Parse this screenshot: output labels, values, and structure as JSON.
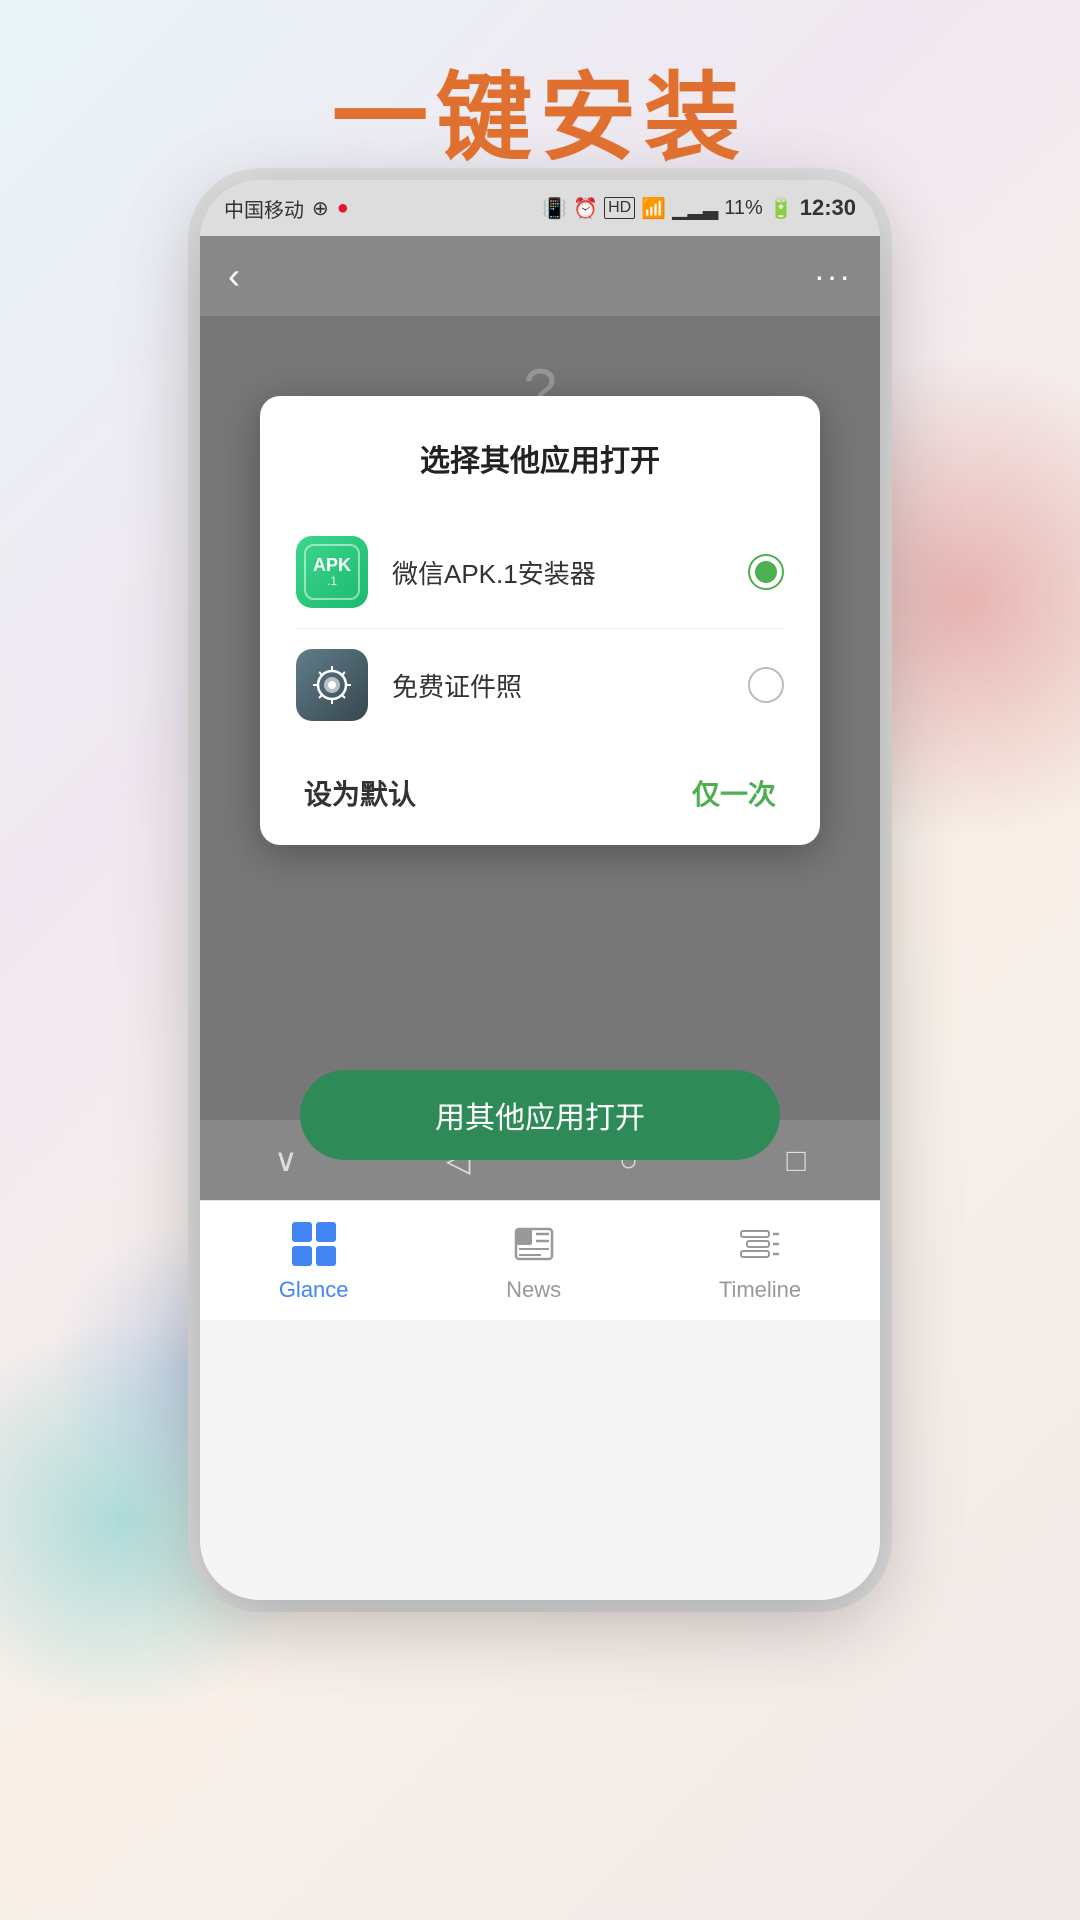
{
  "heading": "一键安装",
  "status_bar": {
    "carrier": "中国移动",
    "time": "12:30",
    "battery": "11%"
  },
  "phone_ui": {
    "dialog": {
      "title": "选择其他应用打开",
      "apps": [
        {
          "name": "微信APK.1安装器",
          "icon_type": "apk",
          "selected": true
        },
        {
          "name": "免费证件照",
          "icon_type": "camera",
          "selected": false
        }
      ],
      "btn_default": "设为默认",
      "btn_once": "仅一次"
    },
    "open_button": "用其他应用打开",
    "nav": {
      "chevron": "∨",
      "back": "◁",
      "home": "○",
      "recent": "□"
    }
  },
  "bottom_tabs": [
    {
      "id": "glance",
      "label": "Glance",
      "active": true
    },
    {
      "id": "news",
      "label": "News",
      "active": false
    },
    {
      "id": "timeline",
      "label": "Timeline",
      "active": false
    }
  ]
}
